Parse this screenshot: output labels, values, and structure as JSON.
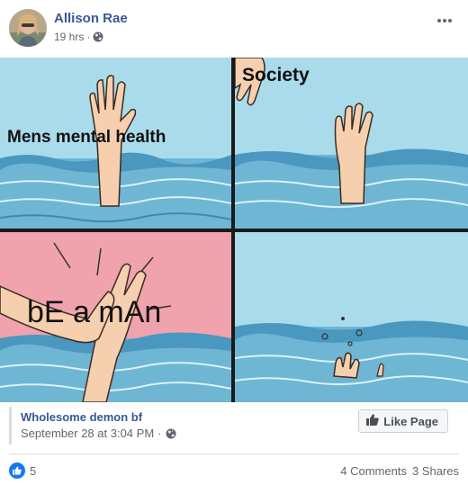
{
  "post": {
    "author": "Allison Rae",
    "time": "19 hrs",
    "separator": "·",
    "privacy_icon": "globe-icon",
    "more_icon": "ellipsis-icon"
  },
  "meme": {
    "panel1_caption": "Mens mental health",
    "panel2_caption": "Society",
    "panel3_caption": "bE a mAn"
  },
  "attribution": {
    "page_name": "Wholesome demon bf",
    "date": "September 28 at 3:04 PM",
    "separator": "·",
    "like_page_label": "Like Page"
  },
  "stats": {
    "reaction_icon": "like-reaction-icon",
    "reaction_count": "5",
    "comments": "4 Comments",
    "shares": "3 Shares"
  },
  "colors": {
    "link_blue": "#385898",
    "reaction_blue": "#1877f2",
    "water": "#a9dbeb",
    "pink_panel": "#f0a3ad"
  }
}
